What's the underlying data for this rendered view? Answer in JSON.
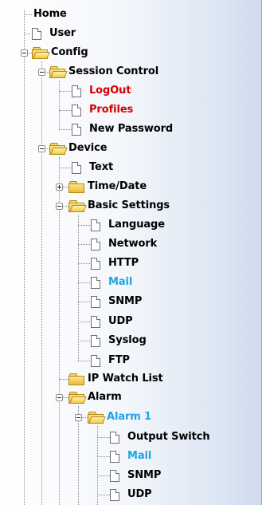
{
  "tree": {
    "home": "Home",
    "user": "User",
    "config": "Config",
    "session_control": "Session Control",
    "logout": "LogOut",
    "profiles": "Profiles",
    "new_password": "New Password",
    "device": "Device",
    "text": "Text",
    "time_date": "Time/Date",
    "basic_settings": "Basic Settings",
    "language": "Language",
    "network": "Network",
    "http": "HTTP",
    "mail": "Mail",
    "snmp": "SNMP",
    "udp": "UDP",
    "syslog": "Syslog",
    "ftp": "FTP",
    "ip_watch_list": "IP Watch List",
    "alarm": "Alarm",
    "alarm1": "Alarm 1",
    "output_switch": "Output Switch",
    "alarm1_mail": "Mail",
    "alarm1_snmp": "SNMP",
    "alarm1_udp": "UDP"
  },
  "colors": {
    "highlight_red": "#d40000",
    "selected_blue": "#1ea3e6"
  }
}
